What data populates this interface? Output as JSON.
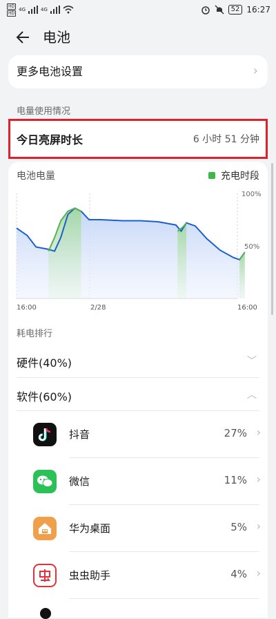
{
  "status_bar": {
    "hd1": "HD",
    "hd2": "HD",
    "net1": "4G",
    "net2": "4G",
    "battery": "52",
    "time": "16:27"
  },
  "header": {
    "title": "电池"
  },
  "more_settings": {
    "label": "更多电池设置"
  },
  "usage_section": {
    "title": "电量使用情况"
  },
  "screen_time": {
    "label": "今日亮屏时长",
    "value": "6 小时 51 分钟"
  },
  "battery_chart": {
    "title": "电池电量",
    "legend": "充电时段",
    "y_labels": [
      "100%",
      "50%"
    ],
    "x_labels": [
      "16:00",
      "2/28",
      "16:00"
    ]
  },
  "chart_data": {
    "type": "area",
    "x_domain": [
      0,
      24
    ],
    "x": [
      0,
      1.2,
      2.2,
      3.5,
      4.3,
      5.0,
      5.8,
      6.6,
      7.3,
      8.2,
      9.5,
      12,
      14,
      16,
      18,
      18.6,
      19.2,
      20.2,
      21.5,
      23,
      24.5,
      25.2,
      25.8
    ],
    "y": [
      67,
      60,
      49,
      47,
      45,
      58,
      80,
      86,
      83,
      75,
      75,
      74,
      74,
      73,
      70,
      64,
      72,
      69,
      57,
      46,
      39,
      37,
      44
    ],
    "ylim": [
      0,
      100
    ],
    "charging_series": [
      {
        "x": [
          3.6,
          4.3,
          5.0,
          5.8,
          6.6,
          7.3
        ],
        "y": [
          45,
          58,
          74,
          83,
          86,
          83
        ]
      },
      {
        "x": [
          18.2,
          18.8,
          19.2
        ],
        "y": [
          64,
          68,
          72
        ]
      },
      {
        "x": [
          25.2,
          25.8
        ],
        "y": [
          37,
          44
        ]
      }
    ],
    "colors": {
      "line": "#1a5fd0",
      "fill": "#c9d8f8",
      "charging": "#55b255"
    }
  },
  "ranking": {
    "title": "耗电排行",
    "hardware": "硬件(40%)",
    "software": "软件(60%)",
    "apps": [
      {
        "name": "抖音",
        "percent": "27%",
        "icon": "douyin-icon",
        "color": "#111111"
      },
      {
        "name": "微信",
        "percent": "11%",
        "icon": "wechat-icon",
        "color": "#2cc157"
      },
      {
        "name": "华为桌面",
        "percent": "5%",
        "icon": "home-icon",
        "color": "#f0a04b"
      },
      {
        "name": "虫虫助手",
        "percent": "4%",
        "icon": "chongchong-icon",
        "color": "#e3303a"
      }
    ]
  }
}
